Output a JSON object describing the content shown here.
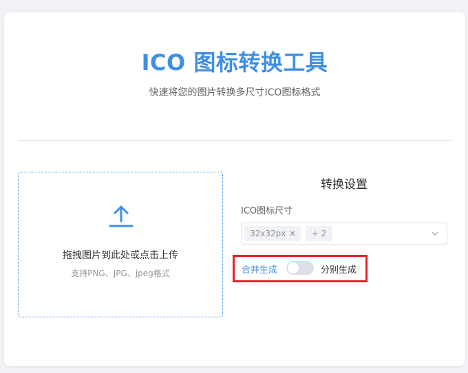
{
  "header": {
    "title": "ICO 图标转换工具",
    "subtitle": "快速将您的图片转换多尺寸ICO图标格式"
  },
  "upload": {
    "icon": "upload-arrow-icon",
    "text": "拖拽图片到此处或点击上传",
    "hint": "支持PNG、JPG、jpeg格式"
  },
  "settings": {
    "title": "转换设置",
    "size_label": "ICO图标尺寸",
    "selected_tag": "32x32px",
    "tag_close": "✕",
    "more_tag": "+ 2",
    "mode_left": "合并生成",
    "mode_right": "分别生成",
    "merge_mode_on": false
  },
  "colors": {
    "accent": "#3f8fe4",
    "highlight": "#e8202a"
  }
}
